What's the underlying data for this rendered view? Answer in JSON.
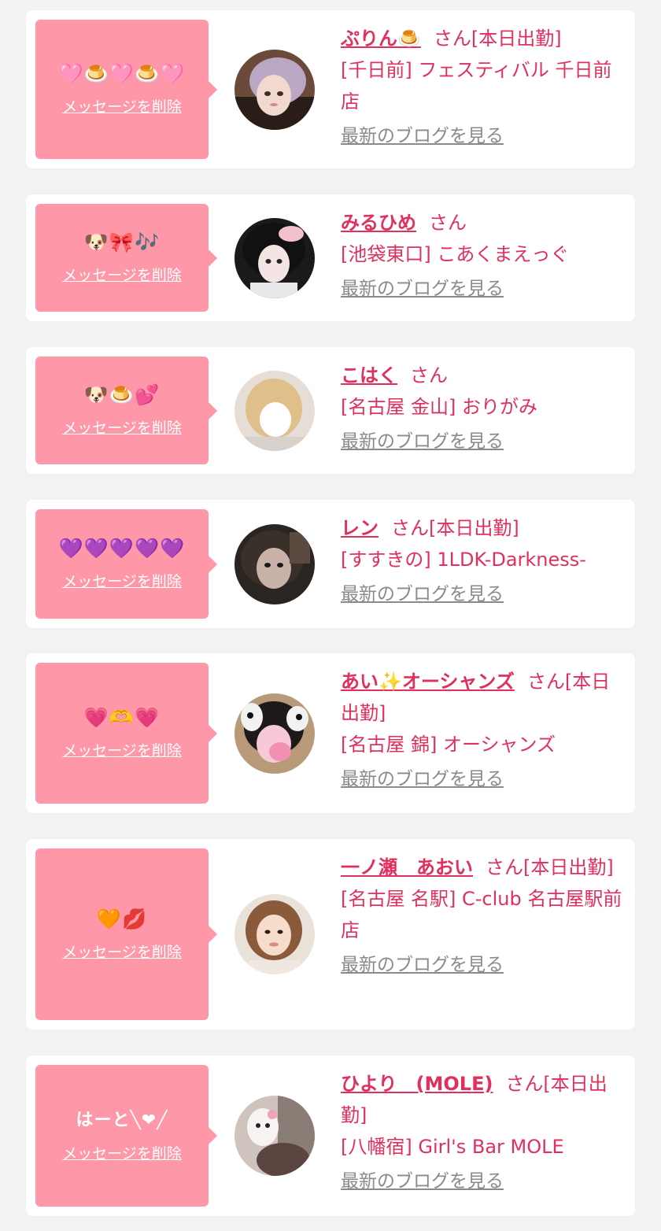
{
  "colors": {
    "background": "#f2f2f2",
    "card": "#ffffff",
    "bubble": "#fe98a9",
    "accent": "#e0305d",
    "link_gray": "#8a8a8a"
  },
  "delete_label": "メッセージを削除",
  "blog_label": "最新のブログを見る",
  "entries": [
    {
      "message": "🩷🍮🩷🍮🩷",
      "name": "ぷりん🍮",
      "suffix": "さん[本日出勤]",
      "shop": "[千日前] フェスティバル 千日前店"
    },
    {
      "message": "🐶🎀🎶",
      "name": "みるひめ",
      "suffix": "さん",
      "shop": "[池袋東口] こあくまえっぐ"
    },
    {
      "message": "🐶🍮💕",
      "name": "こはく",
      "suffix": "さん",
      "shop": "[名古屋 金山] おりがみ"
    },
    {
      "message": "💜💜💜💜💜",
      "name": "レン",
      "suffix": "さん[本日出勤]",
      "shop": "[すすきの] 1LDK-Darkness-"
    },
    {
      "message": "💗🫶💗",
      "name": "あい✨オーシャンズ",
      "suffix": "さん[本日出勤]",
      "shop": "[名古屋 錦] オーシャンズ"
    },
    {
      "message": "🧡💋",
      "name": "一ノ瀬　あおい",
      "suffix": "さん[本日出勤]",
      "shop": "[名古屋 名駅] C-club 名古屋駅前店"
    },
    {
      "message": "はーと╲❤︎╱",
      "name": "ひより　(MOLE)",
      "suffix": "さん[本日出勤]",
      "shop": "[八幡宿] Girl's Bar MOLE"
    }
  ]
}
